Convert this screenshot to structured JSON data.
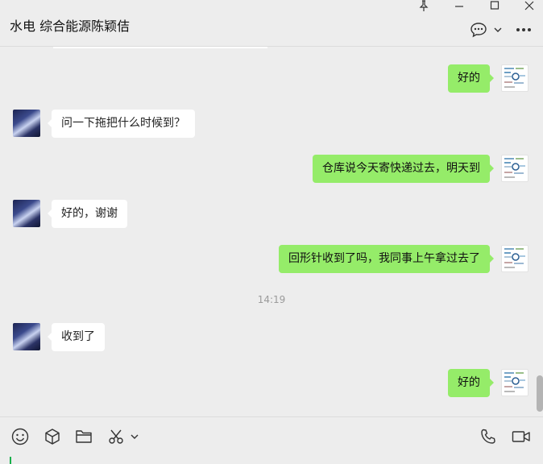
{
  "header": {
    "title": "水电 综合能源陈颖佶"
  },
  "messages": [
    {
      "from": "self",
      "text": "好的"
    },
    {
      "from": "other",
      "text": "问一下拖把什么时候到？"
    },
    {
      "from": "self",
      "text": "仓库说今天寄快递过去，明天到"
    },
    {
      "from": "other",
      "text": "好的，谢谢"
    },
    {
      "from": "self",
      "text": "回形针收到了吗，我同事上午拿过去了"
    },
    {
      "from": "other",
      "text": "收到了"
    },
    {
      "from": "self",
      "text": "好的"
    }
  ],
  "timestamp": "14:19",
  "icons": {
    "window": [
      "pin-icon",
      "minimize-icon",
      "maximize-icon",
      "close-icon"
    ],
    "header": [
      "chat-bubble-icon",
      "chevron-down-icon",
      "more-icon"
    ],
    "toolbar": [
      "emoji-icon",
      "cube-icon",
      "folder-icon",
      "scissors-icon",
      "chevron-down-icon",
      "phone-icon",
      "video-icon"
    ]
  },
  "colors": {
    "background": "#ededed",
    "self_bubble": "#95ec69",
    "other_bubble": "#ffffff",
    "caret": "#18b04b"
  }
}
